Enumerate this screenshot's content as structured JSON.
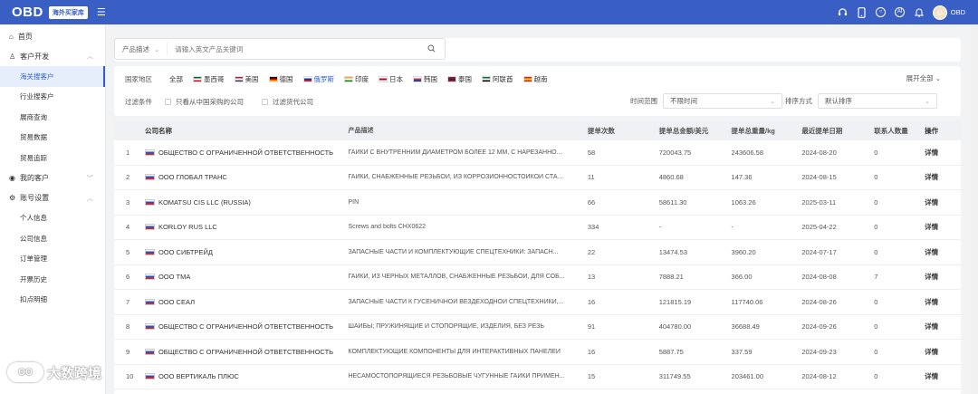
{
  "header": {
    "logo": "OBD",
    "badge": "海外买家库",
    "user_name": "OBD"
  },
  "sidebar": {
    "items": [
      {
        "label": "首页",
        "icon": "home-icon"
      },
      {
        "label": "客户开发",
        "icon": "user-icon",
        "expanded": true,
        "children": [
          "海关搜客户",
          "行业搜客户",
          "展商查询",
          "贸易数据",
          "贸易追踪"
        ]
      },
      {
        "label": "我的客户",
        "icon": "eye-icon",
        "expanded": false
      },
      {
        "label": "账号设置",
        "icon": "gear-icon",
        "expanded": true,
        "children": [
          "个人信息",
          "公司信息",
          "订单管理",
          "开票历史",
          "扣点明细"
        ]
      }
    ]
  },
  "search": {
    "type_label": "产品描述",
    "placeholder": "请输入英文产品关键词"
  },
  "filters": {
    "country_label": "国家地区",
    "countries": [
      {
        "name": "全部",
        "flag": null,
        "active": false
      },
      {
        "name": "墨西哥",
        "flag": [
          "#006847",
          "#ffffff",
          "#ce1126"
        ],
        "active": false
      },
      {
        "name": "美国",
        "flag": [
          "#b22234",
          "#ffffff",
          "#3c3b6e"
        ],
        "active": false
      },
      {
        "name": "德国",
        "flag": [
          "#000000",
          "#dd0000",
          "#ffce00"
        ],
        "active": false
      },
      {
        "name": "俄罗斯",
        "flag": [
          "#ffffff",
          "#0039a6",
          "#d52b1e"
        ],
        "active": true
      },
      {
        "name": "印度",
        "flag": [
          "#ff9933",
          "#ffffff",
          "#138808"
        ],
        "active": false
      },
      {
        "name": "日本",
        "flag": [
          "#ffffff",
          "#bc002d",
          "#ffffff"
        ],
        "active": false
      },
      {
        "name": "韩国",
        "flag": [
          "#ffffff",
          "#cd2e3a",
          "#0047a0"
        ],
        "active": false
      },
      {
        "name": "泰国",
        "flag": [
          "#a51931",
          "#2d2a4a",
          "#a51931"
        ],
        "active": false
      },
      {
        "name": "阿联酋",
        "flag": [
          "#00732f",
          "#ffffff",
          "#000000"
        ],
        "active": false
      },
      {
        "name": "越南",
        "flag": [
          "#da251d",
          "#ffcd00",
          "#da251d"
        ],
        "active": false
      }
    ],
    "expand_label": "展开全部",
    "filter_label": "过滤条件",
    "checkbox_china": "只看从中国采购的公司",
    "checkbox_agent": "过滤货代公司",
    "time_label": "时间范围",
    "time_value": "不限时间",
    "sort_label": "排序方式",
    "sort_value": "默认排序"
  },
  "table": {
    "headers": [
      "公司名称",
      "产品描述",
      "提单次数",
      "提单总金额/美元",
      "提单总重量/kg",
      "最近提单日期",
      "联系人数量",
      "操作"
    ],
    "rows": [
      {
        "no": "1",
        "company": "ОБЩЕСТВО С ОГРАНИЧЕННОЙ ОТВЕТСТВЕННОСТЬ",
        "product": "ГАЙКИ С ВНУТРЕННИМ ДИАМЕТРОМ БОЛЕЕ 12 ММ, С НАРЕЗАННО...",
        "count": "58",
        "amount": "720043.75",
        "weight": "243606.58",
        "date": "2024-08-20",
        "contacts": "0",
        "action": "详情"
      },
      {
        "no": "2",
        "company": "ООО ГЛОБАЛ ТРАНС",
        "product": "ГАЙКИ, СНАБЖЕННЫЕ РЕЗЬБОЙ, ИЗ КОРРОЗИОННОСТОЙКОЙ СТА...",
        "count": "11",
        "amount": "4860.68",
        "weight": "147.36",
        "date": "2024-08-15",
        "contacts": "0",
        "action": "详情"
      },
      {
        "no": "3",
        "company": "KOMATSU CIS LLC (RUSSIA)",
        "product": "PIN",
        "count": "66",
        "amount": "58611.30",
        "weight": "1063.26",
        "date": "2025-03-11",
        "contacts": "0",
        "action": "详情"
      },
      {
        "no": "4",
        "company": "KORLOY RUS LLC",
        "product": "Screws and bolts CHX0622",
        "count": "334",
        "amount": "-",
        "weight": "-",
        "date": "2025-04-22",
        "contacts": "0",
        "action": "详情"
      },
      {
        "no": "5",
        "company": "ООО СИБТРЕЙД",
        "product": "ЗАПАСНЫЕ ЧАСТИ И КОМПЛЕКТУЮЩИЕ СПЕЦТЕХНИКИ: ЗАПАСН...",
        "count": "22",
        "amount": "13474.53",
        "weight": "3960.20",
        "date": "2024-07-17",
        "contacts": "0",
        "action": "详情"
      },
      {
        "no": "6",
        "company": "ООО ТМА",
        "product": "ГАЙКИ, ИЗ ЧЕРНЫХ МЕТАЛЛОВ, СНАБЖЕННЫЕ РЕЗЬБОЙ, ДЛЯ СОБ...",
        "count": "13",
        "amount": "7888.21",
        "weight": "366.00",
        "date": "2024-08-08",
        "contacts": "7",
        "action": "详情"
      },
      {
        "no": "7",
        "company": "ООО СЕАЛ",
        "product": "ЗАПАСНЫЕ ЧАСТИ К ГУСЕНИЧНОЙ ВЕЗДЕХОДНОЙ СПЕЦТЕХНИКИ,...",
        "count": "16",
        "amount": "121815.19",
        "weight": "117740.06",
        "date": "2024-08-26",
        "contacts": "0",
        "action": "详情"
      },
      {
        "no": "8",
        "company": "ОБЩЕСТВО С ОГРАНИЧЕННОЙ ОТВЕТСТВЕННОСТЬ",
        "product": "ШАЙБЫ; ПРУЖИНЯЩИЕ И СТОПОРЯЩИЕ, ИЗДЕЛИЯ, БЕЗ РЕЗЬ",
        "count": "91",
        "amount": "404780.00",
        "weight": "36688.49",
        "date": "2024-09-26",
        "contacts": "0",
        "action": "详情"
      },
      {
        "no": "9",
        "company": "ОБЩЕСТВО С ОГРАНИЧЕННОЙ ОТВЕТСТВЕННОСТЬ",
        "product": "КОМПЛЕКТУЮЩИЕ КОМПОНЕНТЫ ДЛЯ ИНТЕРАКТИВНЫХ ПАНЕЛЕЙ",
        "count": "16",
        "amount": "5887.75",
        "weight": "337.59",
        "date": "2024-09-23",
        "contacts": "0",
        "action": "详情"
      },
      {
        "no": "10",
        "company": "ООО ВЕРТИКАЛЬ ПЛЮС",
        "product": "НЕСАМОСТОПОРЯЩИЕСЯ РЕЗЬБОВЫЕ ЧУГУННЫЕ ГАЙКИ ПРИМЕН...",
        "count": "15",
        "amount": "311749.55",
        "weight": "203461.00",
        "date": "2024-08-12",
        "contacts": "0",
        "action": "详情"
      }
    ]
  },
  "watermark": {
    "text": "大数跨境"
  }
}
